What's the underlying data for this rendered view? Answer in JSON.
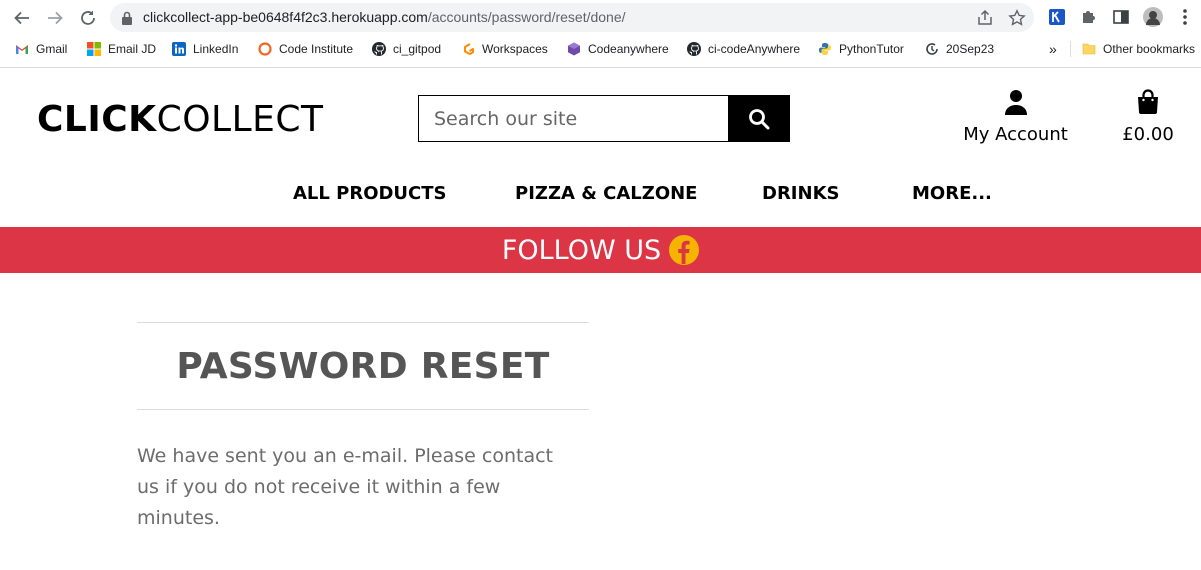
{
  "browser": {
    "url_host": "clickcollect-app-be0648f4f2c3.herokuapp.com",
    "url_path": "/accounts/password/reset/done/",
    "bookmarks": [
      {
        "label": "Gmail",
        "icon": "gmail-icon"
      },
      {
        "label": "Email JD",
        "icon": "microsoft-icon"
      },
      {
        "label": "LinkedIn",
        "icon": "linkedin-icon"
      },
      {
        "label": "Code Institute",
        "icon": "code-institute-icon"
      },
      {
        "label": "ci_gitpod",
        "icon": "github-icon"
      },
      {
        "label": "Workspaces",
        "icon": "gitpod-icon"
      },
      {
        "label": "Codeanywhere",
        "icon": "codeanywhere-icon"
      },
      {
        "label": "ci-codeAnywhere",
        "icon": "github-icon"
      },
      {
        "label": "PythonTutor",
        "icon": "python-icon"
      },
      {
        "label": "20Sep23",
        "icon": "clock-icon"
      }
    ],
    "overflow": "»",
    "other_bookmarks": "Other bookmarks"
  },
  "header": {
    "logo_bold": "CLICK",
    "logo_light": "COLLECT",
    "search_placeholder": "Search our site",
    "account_label": "My Account",
    "bag_total": "£0.00"
  },
  "nav": {
    "items": [
      "ALL PRODUCTS",
      "PIZZA & CALZONE",
      "DRINKS",
      "MORE..."
    ]
  },
  "banner": {
    "text": "FOLLOW US",
    "color": "#dc3545",
    "icon_color": "#f6b400"
  },
  "main": {
    "title": "PASSWORD RESET",
    "message": "We have sent you an e-mail. Please contact us if you do not receive it within a few minutes."
  }
}
